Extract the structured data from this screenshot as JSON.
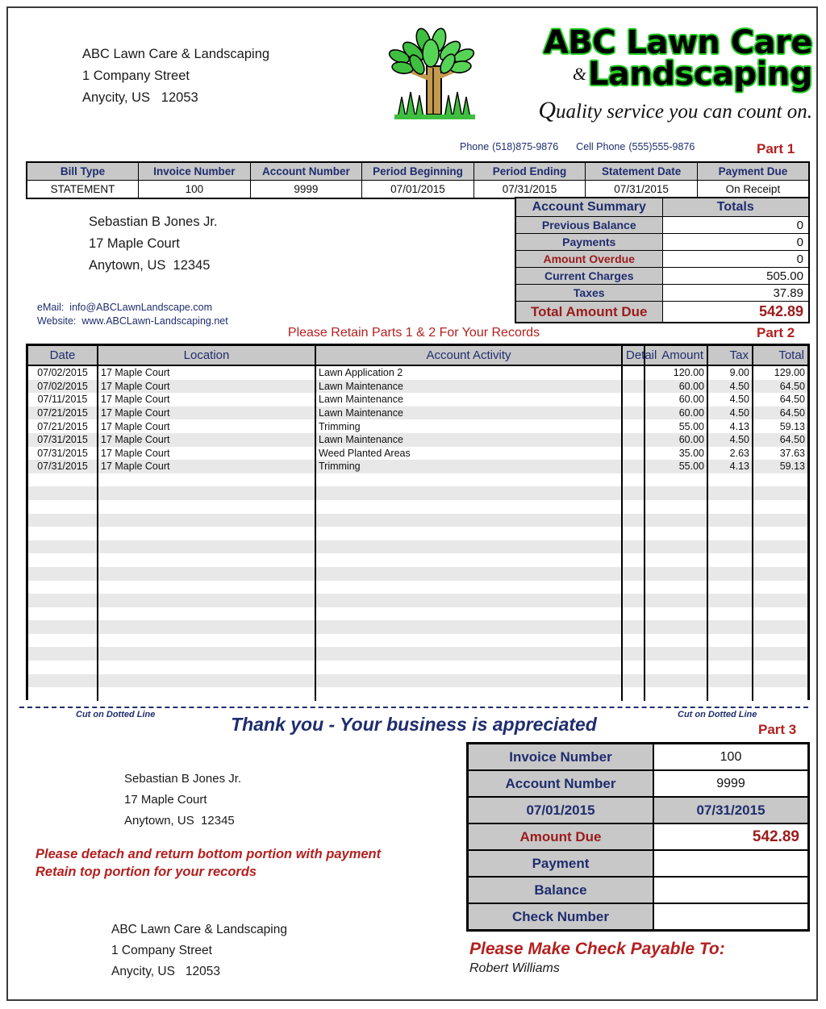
{
  "company": {
    "name": "ABC Lawn Care & Landscaping",
    "street": "1 Company Street",
    "citystatezip": "Anycity, US   12053"
  },
  "logo": {
    "line1": "ABC Lawn Care",
    "ampersand": "&",
    "line2": "Landscaping",
    "tagline_first": "Q",
    "tagline_rest": "uality service you can count on.",
    "art": "tree-and-grass-logo"
  },
  "contact_header": {
    "phone_label": "Phone",
    "phone_value": "(518)875-9876",
    "cell_label": "Cell Phone",
    "cell_value": "(555)555-9876"
  },
  "parts": {
    "part1": "Part 1",
    "part2": "Part 2",
    "part3": "Part 3"
  },
  "info_table": {
    "headers": [
      "Bill Type",
      "Invoice Number",
      "Account Number",
      "Period Beginning",
      "Period Ending",
      "Statement Date",
      "Payment Due"
    ],
    "values": [
      "STATEMENT",
      "100",
      "9999",
      "07/01/2015",
      "07/31/2015",
      "07/31/2015",
      "On Receipt"
    ]
  },
  "customer": {
    "name": "Sebastian B Jones Jr.",
    "street": "17 Maple Court",
    "citystatezip": "Anytown, US  12345"
  },
  "contact_block": {
    "email_label": "eMail:",
    "email_value": "info@ABCLawnLandscape.com",
    "website_label": "Website:",
    "website_value": "www.ABCLawn-Landscaping.net"
  },
  "account_summary": {
    "title": "Account Summary",
    "totals_header": "Totals",
    "rows": [
      {
        "label": "Previous Balance",
        "value": "0",
        "red": false
      },
      {
        "label": "Payments",
        "value": "0",
        "red": false
      },
      {
        "label": "Amount Overdue",
        "value": "0",
        "red": true
      },
      {
        "label": "Current Charges",
        "value": "505.00",
        "red": false
      },
      {
        "label": "Taxes",
        "value": "37.89",
        "red": false
      }
    ],
    "total_label": "Total Amount Due",
    "total_value": "542.89"
  },
  "retain_notice": "Please Retain Parts 1 & 2 For Your Records",
  "activity": {
    "headers": [
      "Date",
      "Location",
      "Account Activity",
      "Detail",
      "Amount",
      "Tax",
      "Total"
    ],
    "rows": [
      {
        "date": "07/02/2015",
        "location": "17 Maple Court",
        "activity": "Lawn Application 2",
        "detail": "",
        "amount": "120.00",
        "tax": "9.00",
        "total": "129.00"
      },
      {
        "date": "07/02/2015",
        "location": "17 Maple Court",
        "activity": "Lawn Maintenance",
        "detail": "",
        "amount": "60.00",
        "tax": "4.50",
        "total": "64.50"
      },
      {
        "date": "07/11/2015",
        "location": "17 Maple Court",
        "activity": "Lawn Maintenance",
        "detail": "",
        "amount": "60.00",
        "tax": "4.50",
        "total": "64.50"
      },
      {
        "date": "07/21/2015",
        "location": "17 Maple Court",
        "activity": "Lawn Maintenance",
        "detail": "",
        "amount": "60.00",
        "tax": "4.50",
        "total": "64.50"
      },
      {
        "date": "07/21/2015",
        "location": "17 Maple Court",
        "activity": "Trimming",
        "detail": "",
        "amount": "55.00",
        "tax": "4.13",
        "total": "59.13"
      },
      {
        "date": "07/31/2015",
        "location": "17 Maple Court",
        "activity": "Lawn Maintenance",
        "detail": "",
        "amount": "60.00",
        "tax": "4.50",
        "total": "64.50"
      },
      {
        "date": "07/31/2015",
        "location": "17 Maple Court",
        "activity": "Weed Planted Areas",
        "detail": "",
        "amount": "35.00",
        "tax": "2.63",
        "total": "37.63"
      },
      {
        "date": "07/31/2015",
        "location": "17 Maple Court",
        "activity": "Trimming",
        "detail": "",
        "amount": "55.00",
        "tax": "4.13",
        "total": "59.13"
      }
    ],
    "blank_row_count": 17
  },
  "cut_line": {
    "left_label": "Cut on Dotted Line",
    "right_label": "Cut on Dotted Line"
  },
  "thank_you": "Thank you - Your business is appreciated",
  "stub": {
    "rows": [
      {
        "label": "Invoice Number",
        "value": "100",
        "style": "plain"
      },
      {
        "label": "Account Number",
        "value": "9999",
        "style": "plain"
      },
      {
        "label": "07/01/2015",
        "value": "07/31/2015",
        "style": "shaded"
      },
      {
        "label": "Amount Due",
        "value": "542.89",
        "style": "amount"
      },
      {
        "label": "Payment",
        "value": "",
        "style": "plain"
      },
      {
        "label": "Balance",
        "value": "",
        "style": "plain"
      },
      {
        "label": "Check Number",
        "value": "",
        "style": "plain"
      }
    ]
  },
  "stub_customer": {
    "name": "Sebastian B Jones Jr.",
    "street": "17 Maple Court",
    "citystatezip": "Anytown, US  12345"
  },
  "detach_note": {
    "line1": "Please detach and return bottom portion with payment",
    "line2": "Retain top portion for your records"
  },
  "stub_company": {
    "name": "ABC Lawn Care & Landscaping",
    "street": "1 Company Street",
    "citystatezip": "Anycity, US   12053"
  },
  "payable": {
    "title": "Please Make Check Payable To:",
    "name": "Robert Williams"
  },
  "colors": {
    "header_fill": "#c8c8c8",
    "header_text": "#1f2d6e",
    "accent_red": "#b32020",
    "dark_red": "#9b1b1b",
    "zebra": "#e8e8e8",
    "logo_green": "#22cc22"
  }
}
